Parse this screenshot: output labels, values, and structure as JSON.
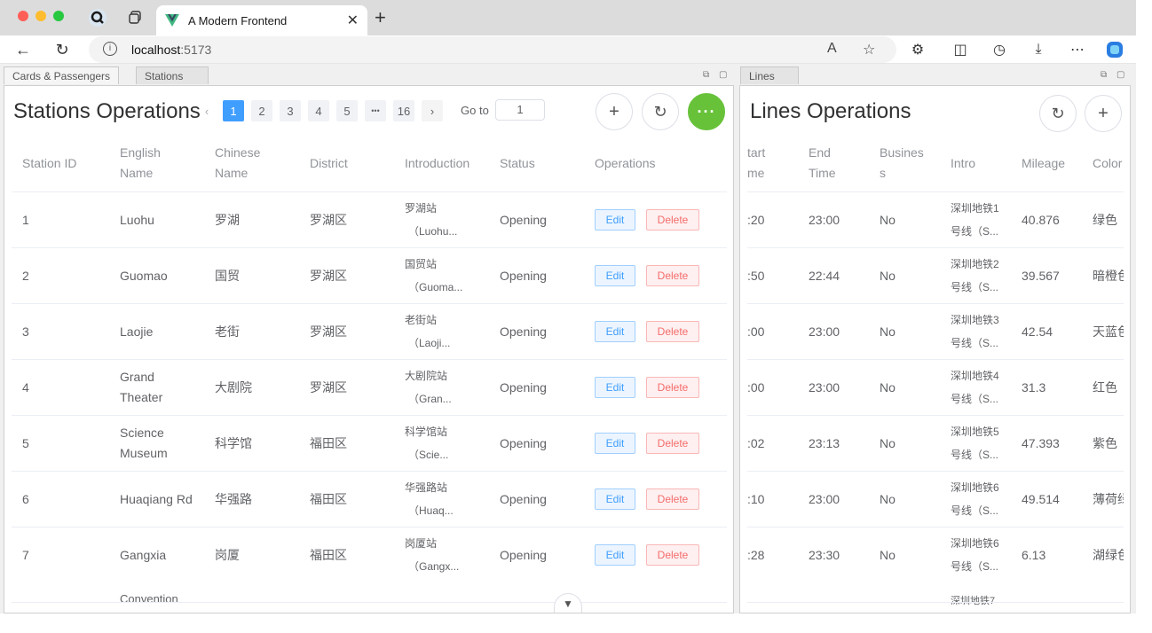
{
  "browser": {
    "tab_title": "A Modern Frontend",
    "url_host": "localhost",
    "url_port": ":5173"
  },
  "left_pane": {
    "tabs": [
      "Cards & Passengers",
      "Stations"
    ],
    "title": "Stations Operations",
    "pagination": {
      "pages": [
        "1",
        "2",
        "3",
        "4",
        "5",
        "•••",
        "16"
      ],
      "current": "1",
      "goto_label": "Go to",
      "goto_value": "1"
    },
    "columns": [
      "Station ID",
      "English Name",
      "Chinese Name",
      "District",
      "Introduction",
      "Status",
      "Operations"
    ],
    "edit_label": "Edit",
    "delete_label": "Delete",
    "rows": [
      {
        "id": "1",
        "en1": "Luohu",
        "en2": "",
        "zh": "罗湖",
        "district": "罗湖区",
        "intro1": "罗湖站",
        "intro2": "（Luohu...",
        "status": "Opening"
      },
      {
        "id": "2",
        "en1": "Guomao",
        "en2": "",
        "zh": "国贸",
        "district": "罗湖区",
        "intro1": "国贸站",
        "intro2": "（Guoma...",
        "status": "Opening"
      },
      {
        "id": "3",
        "en1": "Laojie",
        "en2": "",
        "zh": "老街",
        "district": "罗湖区",
        "intro1": "老街站",
        "intro2": "（Laoji...",
        "status": "Opening"
      },
      {
        "id": "4",
        "en1": "Grand",
        "en2": "Theater",
        "zh": "大剧院",
        "district": "罗湖区",
        "intro1": "大剧院站",
        "intro2": "（Gran...",
        "status": "Opening"
      },
      {
        "id": "5",
        "en1": "Science",
        "en2": "Museum",
        "zh": "科学馆",
        "district": "福田区",
        "intro1": "科学馆站",
        "intro2": "（Scie...",
        "status": "Opening"
      },
      {
        "id": "6",
        "en1": "Huaqiang Rd",
        "en2": "",
        "zh": "华强路",
        "district": "福田区",
        "intro1": "华强路站",
        "intro2": "（Huaq...",
        "status": "Opening"
      },
      {
        "id": "7",
        "en1": "Gangxia",
        "en2": "",
        "zh": "岗厦",
        "district": "福田区",
        "intro1": "岗厦站",
        "intro2": "（Gangx...",
        "status": "Opening"
      }
    ],
    "partial_row_text": "Convention"
  },
  "right_pane": {
    "tabs": [
      "Lines"
    ],
    "title": "Lines Operations",
    "columns": {
      "start1": "tart",
      "start2": "me",
      "end1": "End",
      "end2": "Time",
      "bus1": "Busines",
      "bus2": "s",
      "intro": "Intro",
      "mileage": "Mileage",
      "color": "Color"
    },
    "rows": [
      {
        "start": ":20",
        "end": "23:00",
        "bus": "No",
        "intro1": "深圳地铁1",
        "intro2": "号线（S...",
        "mileage": "40.876",
        "color": "绿色"
      },
      {
        "start": ":50",
        "end": "22:44",
        "bus": "No",
        "intro1": "深圳地铁2",
        "intro2": "号线（S...",
        "mileage": "39.567",
        "color": "暗橙色"
      },
      {
        "start": ":00",
        "end": "23:00",
        "bus": "No",
        "intro1": "深圳地铁3",
        "intro2": "号线（S...",
        "mileage": "42.54",
        "color": "天蓝色"
      },
      {
        "start": ":00",
        "end": "23:00",
        "bus": "No",
        "intro1": "深圳地铁4",
        "intro2": "号线（S...",
        "mileage": "31.3",
        "color": "红色"
      },
      {
        "start": ":02",
        "end": "23:13",
        "bus": "No",
        "intro1": "深圳地铁5",
        "intro2": "号线（S...",
        "mileage": "47.393",
        "color": "紫色"
      },
      {
        "start": ":10",
        "end": "23:00",
        "bus": "No",
        "intro1": "深圳地铁6",
        "intro2": "号线（S...",
        "mileage": "49.514",
        "color": "薄荷绿"
      },
      {
        "start": ":28",
        "end": "23:30",
        "bus": "No",
        "intro1": "深圳地铁6",
        "intro2": "号线（S...",
        "mileage": "6.13",
        "color": "湖绿色"
      }
    ],
    "partial_row_text": "深圳地铁7"
  },
  "colors": {
    "primary": "#409eff",
    "success": "#67c23a",
    "danger": "#f56c6c"
  }
}
